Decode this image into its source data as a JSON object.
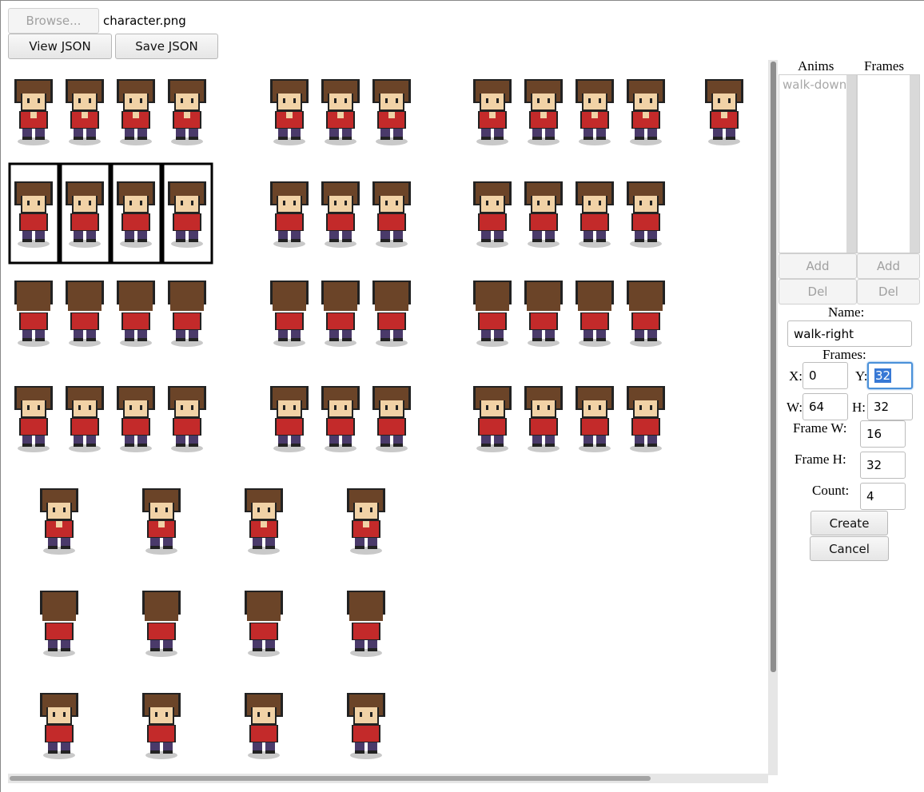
{
  "toolbar": {
    "browse_label": "Browse...",
    "file_name": "character.png",
    "view_json_label": "View JSON",
    "save_json_label": "Save JSON"
  },
  "panel": {
    "anims_header": "Anims",
    "frames_header": "Frames",
    "anims": [
      "walk-down"
    ],
    "add_anim_label": "Add",
    "add_frame_label": "Add",
    "del_anim_label": "Del",
    "del_frame_label": "Del",
    "name_label": "Name:",
    "name_value": "walk-right",
    "frames_label": "Frames:",
    "x_label": "X:",
    "x_value": "0",
    "y_label": "Y:",
    "y_value": "32",
    "w_label": "W:",
    "w_value": "64",
    "h_label": "H:",
    "h_value": "32",
    "frame_w_label": "Frame W:",
    "frame_w_value": "16",
    "frame_h_label": "Frame H:",
    "frame_h_value": "32",
    "count_label": "Count:",
    "count_value": "4",
    "create_label": "Create",
    "cancel_label": "Cancel"
  },
  "colors": {
    "hair": "#6b4428",
    "skin": "#f1d2a6",
    "shirt": "#c32a2a",
    "pants": "#4a3a6a",
    "shadow": "#c9c9c9",
    "selection": "#3778d5"
  }
}
